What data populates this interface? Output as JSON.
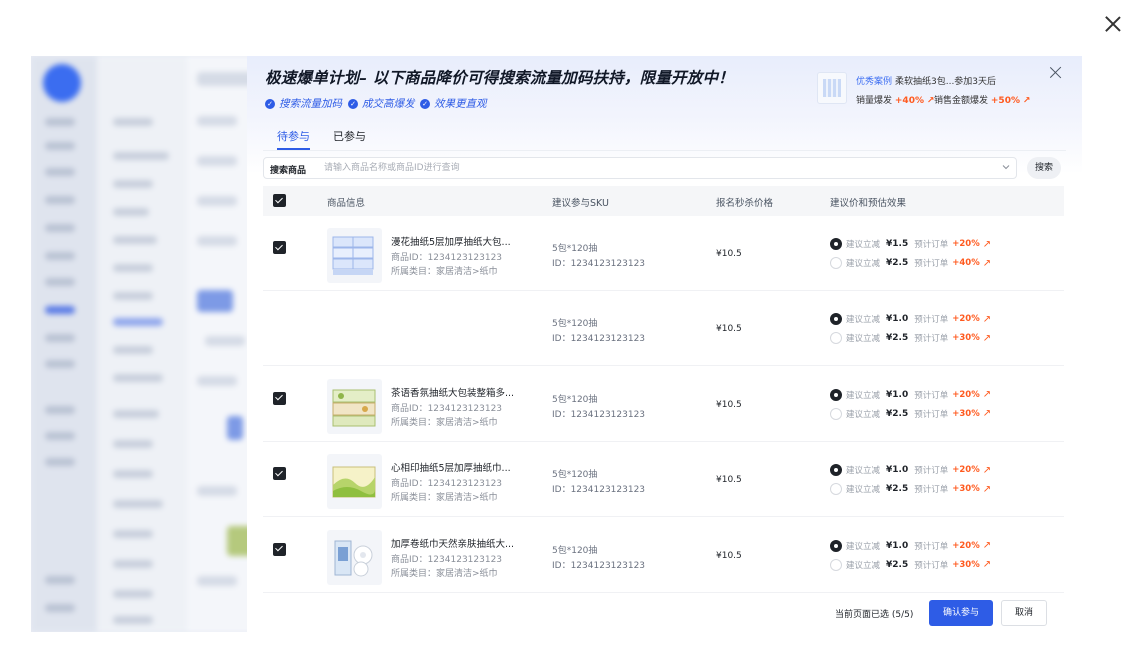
{
  "modal": {
    "title": "极速爆单计划– 以下商品降价可得搜索流量加码扶持，限量开放中！",
    "perks": [
      "搜索流量加码",
      "成交高爆发",
      "效果更直观"
    ],
    "case": {
      "tag": "优秀案例",
      "name": "柔软抽纸3包...参加3天后",
      "metric1_label": "销量爆发",
      "metric1_value": "+40%",
      "metric2_label": "销售金额爆发",
      "metric2_value": "+50%"
    },
    "tabs": [
      {
        "label": "待参与",
        "active": true
      },
      {
        "label": "已参与",
        "active": false
      }
    ],
    "search": {
      "label": "搜索商品",
      "placeholder": "请输入商品名称或商品ID进行查询",
      "button": "搜索"
    },
    "columns": [
      "商品信息",
      "建议参与SKU",
      "报名秒杀价格",
      "建议价和预估效果"
    ],
    "option_label": "建议立减",
    "forecast_label": "预计订单",
    "rows": [
      {
        "checked": true,
        "thumb": "paper-tissue-blue",
        "name": "漫花抽纸5层加厚抽纸大包...",
        "id": "商品ID：1234123123123",
        "category": "所属类目：家居清洁>纸巾",
        "sku_spec": "5包*120抽",
        "sku_id": "ID：1234123123123",
        "price": "¥10.5",
        "options": [
          {
            "selected": true,
            "amount": "¥1.5",
            "increase": "+20%"
          },
          {
            "selected": false,
            "amount": "¥2.5",
            "increase": "+40%"
          }
        ]
      },
      {
        "checked": false,
        "thumb": "",
        "name": "",
        "id": "",
        "category": "",
        "sku_spec": "5包*120抽",
        "sku_id": "ID：1234123123123",
        "price": "¥10.5",
        "options": [
          {
            "selected": true,
            "amount": "¥1.0",
            "increase": "+20%"
          },
          {
            "selected": false,
            "amount": "¥2.5",
            "increase": "+30%"
          }
        ]
      },
      {
        "checked": true,
        "thumb": "paper-tissue-green",
        "name": "茶语香氛抽纸大包装整箱多...",
        "id": "商品ID：1234123123123",
        "category": "所属类目：家居清洁>纸巾",
        "sku_spec": "5包*120抽",
        "sku_id": "ID：1234123123123",
        "price": "¥10.5",
        "options": [
          {
            "selected": true,
            "amount": "¥1.0",
            "increase": "+20%"
          },
          {
            "selected": false,
            "amount": "¥2.5",
            "increase": "+30%"
          }
        ]
      },
      {
        "checked": true,
        "thumb": "paper-tissue-yellow",
        "name": "心相印抽纸5层加厚抽纸巾...",
        "id": "商品ID：1234123123123",
        "category": "所属类目：家居清洁>纸巾",
        "sku_spec": "5包*120抽",
        "sku_id": "ID：1234123123123",
        "price": "¥10.5",
        "options": [
          {
            "selected": true,
            "amount": "¥1.0",
            "increase": "+20%"
          },
          {
            "selected": false,
            "amount": "¥2.5",
            "increase": "+30%"
          }
        ]
      },
      {
        "checked": true,
        "thumb": "paper-roll-white",
        "name": "加厚卷纸巾天然亲肤抽纸大...",
        "id": "商品ID：1234123123123",
        "category": "所属类目：家居清洁>纸巾",
        "sku_spec": "5包*120抽",
        "sku_id": "ID：1234123123123",
        "price": "¥10.5",
        "options": [
          {
            "selected": true,
            "amount": "¥1.0",
            "increase": "+20%"
          },
          {
            "selected": false,
            "amount": "¥2.5",
            "increase": "+30%"
          }
        ]
      }
    ],
    "footer": {
      "status": "当前页面已选 (5/5)",
      "confirm": "确认参与",
      "cancel": "取消"
    }
  },
  "colors": {
    "accent": "#2e5ce6",
    "increase": "#ff5a1f"
  }
}
